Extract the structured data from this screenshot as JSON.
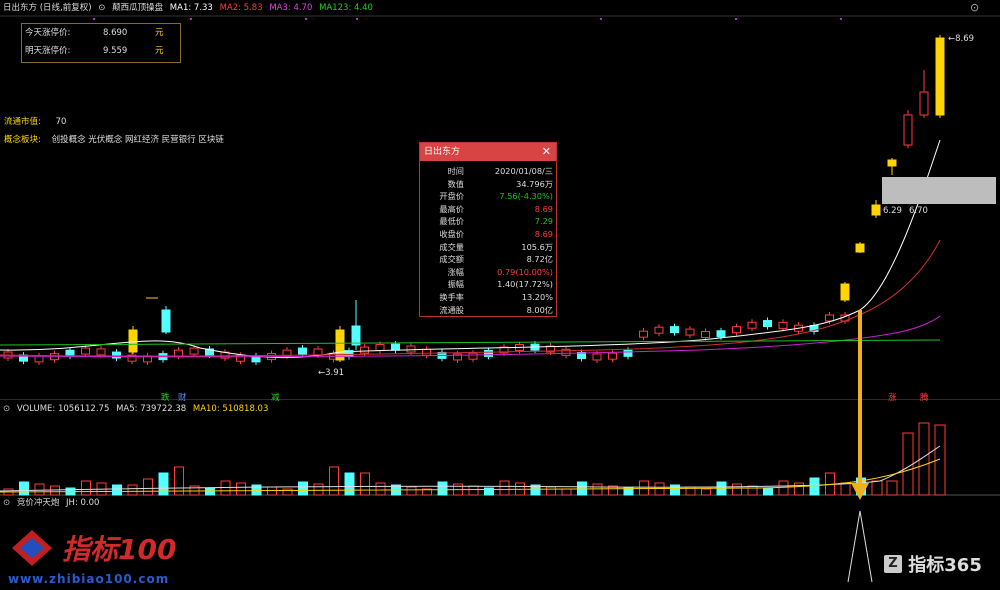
{
  "header": {
    "stock": "日出东方 (日线,前复权)",
    "indicator": "颠西瓜顶操盘",
    "ma1": "MA1: 7.33",
    "ma2": "MA2: 5.83",
    "ma3": "MA3: 4.70",
    "ma123": "MA123: 4.40"
  },
  "limit_box": {
    "today_label": "今天涨停价:",
    "today_value": "8.690",
    "tomorrow_label": "明天涨停价:",
    "tomorrow_value": "9.559",
    "unit": "元"
  },
  "float_mv": {
    "label": "流通市值:",
    "value": "70"
  },
  "concepts": {
    "label": "概念板块:",
    "value": "创投概念 光伏概念 网红经济 民营银行 区块链"
  },
  "price_labels": {
    "high": "8.69",
    "low": "3.91",
    "range_low": "6.29",
    "range_high": "6.70"
  },
  "signals": {
    "die": "跌",
    "cai": "财",
    "jian": "减",
    "zhang": "涨",
    "teng": "腾"
  },
  "volume_header": {
    "title": "VOLUME: 1056112.75",
    "ma5": "MA5: 739722.38",
    "ma10": "MA10: 510818.03"
  },
  "jh_header": {
    "title": "竞价冲天炮",
    "jh": "JH: 0.00"
  },
  "popup": {
    "title": "日出东方",
    "close": "✕",
    "rows": [
      {
        "k": "时间",
        "v": "2020/01/08/三",
        "c": "white"
      },
      {
        "k": "数值",
        "v": "34.796万",
        "c": "white"
      },
      {
        "k": "开盘价",
        "v": "7.56(-4.30%)",
        "c": "green"
      },
      {
        "k": "最高价",
        "v": "8.69",
        "c": "red"
      },
      {
        "k": "最低价",
        "v": "7.29",
        "c": "green"
      },
      {
        "k": "收盘价",
        "v": "8.69",
        "c": "red"
      },
      {
        "k": "成交量",
        "v": "105.6万",
        "c": "white"
      },
      {
        "k": "成交额",
        "v": "8.72亿",
        "c": "white"
      },
      {
        "k": "涨幅",
        "v": "0.79(10.00%)",
        "c": "red"
      },
      {
        "k": "振幅",
        "v": "1.40(17.72%)",
        "c": "white"
      },
      {
        "k": "换手率",
        "v": "13.20%",
        "c": "white"
      },
      {
        "k": "流通股",
        "v": "8.00亿",
        "c": "white"
      }
    ]
  },
  "watermarks": {
    "left_brand": "指标100",
    "left_url": "www.zhibiao100.com",
    "right_brand": "指标365"
  },
  "colors": {
    "up": "#ff3b3b",
    "down": "#54ffff",
    "limit": "#ffd400",
    "ma1": "#ffffff",
    "ma2": "#d03030",
    "ma3": "#d020d0",
    "ma123": "#20c020"
  }
}
